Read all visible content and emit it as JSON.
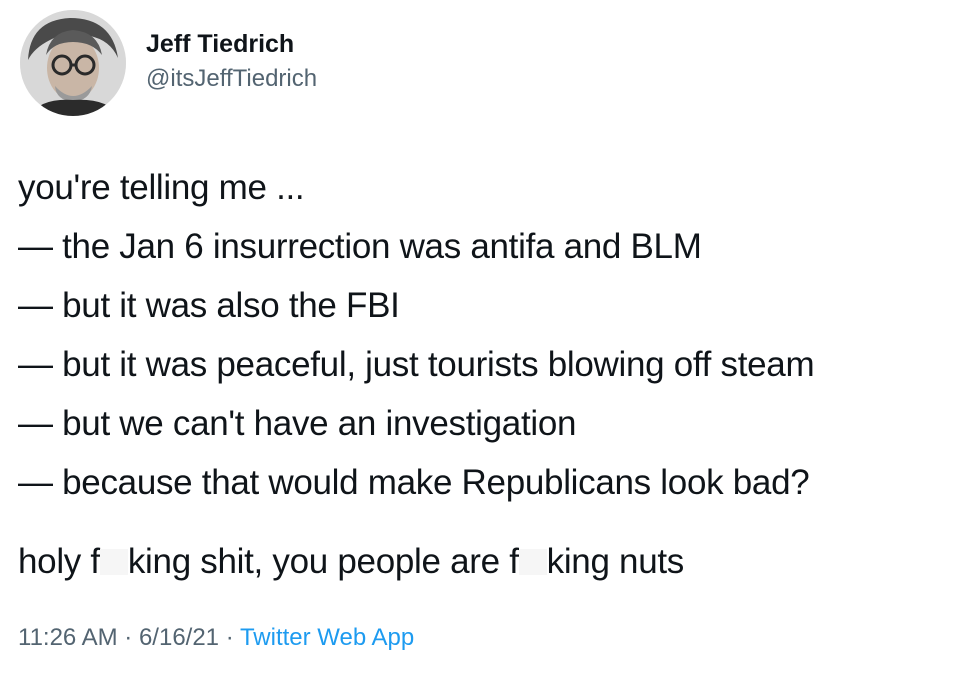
{
  "author": {
    "display_name": "Jeff Tiedrich",
    "handle": "@itsJeffTiedrich"
  },
  "tweet": {
    "lines": [
      "you're telling me ...",
      "— the Jan 6 insurrection was antifa and BLM",
      "— but it was also the FBI",
      "— but it was peaceful, just tourists blowing off steam",
      "— but we can't have an investigation",
      "— because that would make Republicans look bad?"
    ],
    "final_line": {
      "part1": "holy f",
      "part2": "king shit, you people are f",
      "part3": "king nuts"
    }
  },
  "meta": {
    "time": "11:26 AM",
    "separator": " · ",
    "date": "6/16/21",
    "source": "Twitter Web App"
  },
  "colors": {
    "text": "#0f1419",
    "secondary": "#536471",
    "link": "#1d9bf0"
  }
}
